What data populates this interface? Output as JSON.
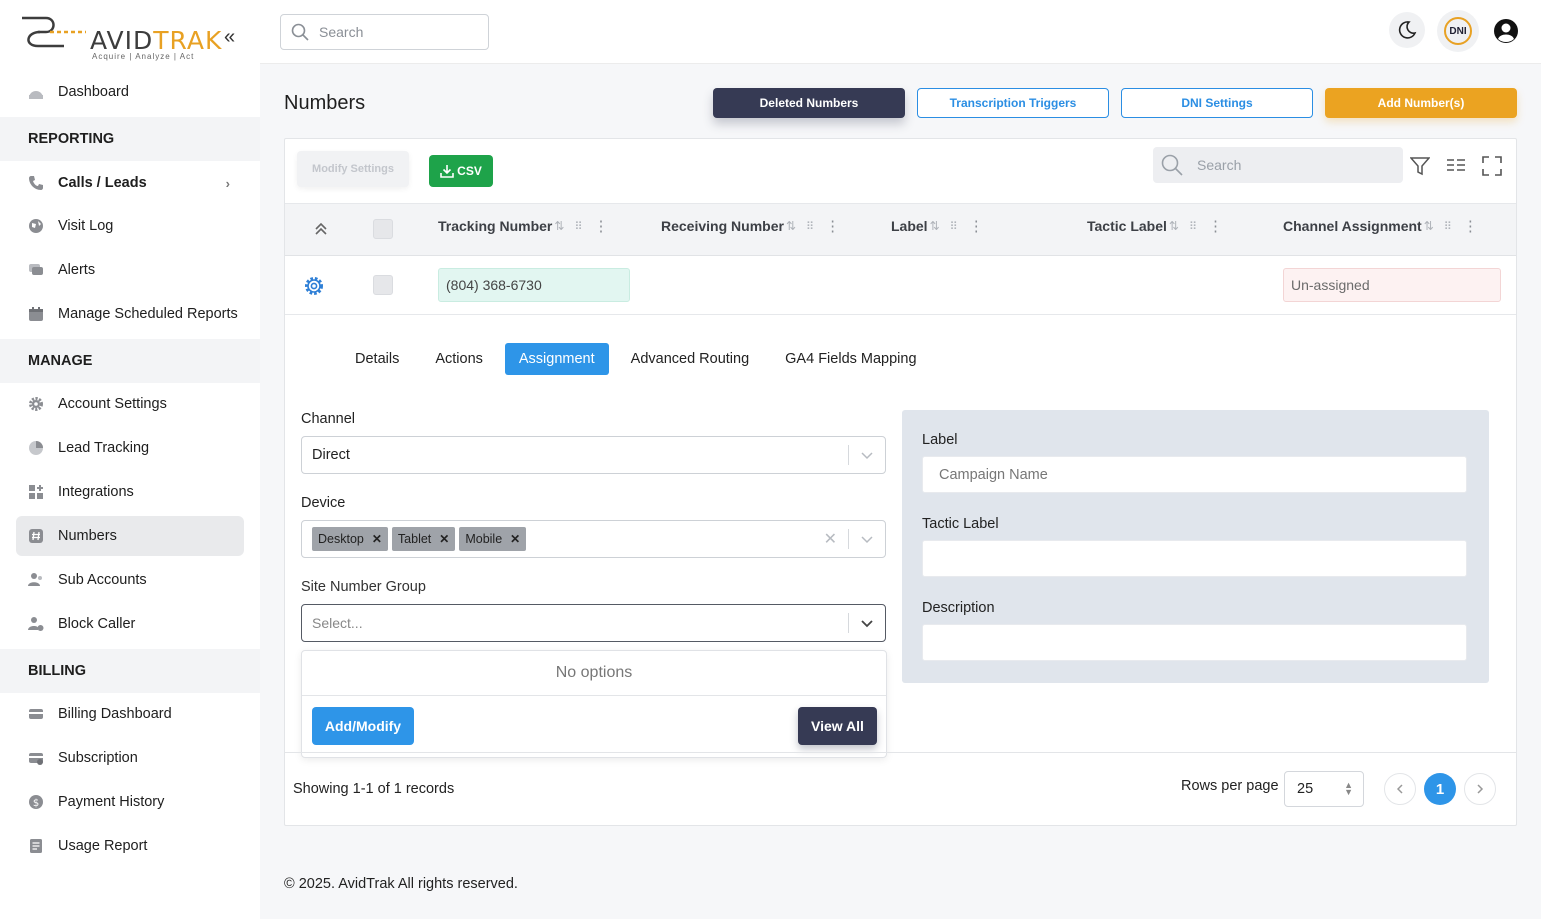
{
  "brand": {
    "name_prefix": "AVID",
    "name_suffix": "TRAK",
    "tagline": "Acquire  |  Analyze  |  Act"
  },
  "sidebar": {
    "items": [
      {
        "label": "Dashboard",
        "icon": "dashboard-icon"
      },
      {
        "section": "REPORTING"
      },
      {
        "label": "Calls / Leads",
        "icon": "phone-icon"
      },
      {
        "label": "Visit Log",
        "icon": "globe-icon"
      },
      {
        "label": "Alerts",
        "icon": "chat-icon"
      },
      {
        "label": "Manage Scheduled Reports",
        "icon": "calendar-icon"
      },
      {
        "section": "MANAGE"
      },
      {
        "label": "Account Settings",
        "icon": "gear-icon"
      },
      {
        "label": "Lead Tracking",
        "icon": "pie-icon"
      },
      {
        "label": "Integrations",
        "icon": "grid-plus-icon"
      },
      {
        "label": "Numbers",
        "icon": "hash-icon"
      },
      {
        "label": "Sub Accounts",
        "icon": "users-icon"
      },
      {
        "label": "Block Caller",
        "icon": "user-block-icon"
      },
      {
        "section": "BILLING"
      },
      {
        "label": "Billing Dashboard",
        "icon": "card-icon"
      },
      {
        "label": "Subscription",
        "icon": "card-gear-icon"
      },
      {
        "label": "Payment History",
        "icon": "dollar-icon"
      },
      {
        "label": "Usage Report",
        "icon": "report-icon"
      }
    ]
  },
  "topbar": {
    "search_placeholder": "Search",
    "dni_badge": "DNI"
  },
  "page": {
    "title": "Numbers",
    "buttons": {
      "deleted": "Deleted Numbers",
      "transcription": "Transcription Triggers",
      "dni": "DNI Settings",
      "add": "Add Number(s)"
    }
  },
  "table": {
    "modify_settings": "Modify Settings",
    "csv": "CSV",
    "search_placeholder": "Search",
    "columns": [
      "Tracking Number",
      "Receiving Number",
      "Label",
      "Tactic Label",
      "Channel Assignment"
    ],
    "row": {
      "tracking_number": "(804) 368-6730",
      "channel_assignment": "Un-assigned"
    },
    "tabs": [
      "Details",
      "Actions",
      "Assignment",
      "Advanced Routing",
      "GA4 Fields Mapping"
    ],
    "active_tab": "Assignment",
    "form": {
      "channel_label": "Channel",
      "channel_value": "Direct",
      "device_label": "Device",
      "devices": [
        "Desktop",
        "Tablet",
        "Mobile"
      ],
      "site_group_label": "Site Number Group",
      "site_group_placeholder": "Select...",
      "no_options": "No options",
      "add_modify": "Add/Modify",
      "view_all": "View All"
    },
    "panel": {
      "label_label": "Label",
      "label_placeholder": "Campaign Name",
      "tactic_label": "Tactic Label",
      "description_label": "Description"
    },
    "footer": {
      "records": "Showing 1-1 of 1 records",
      "rows_per_page_label": "Rows per page",
      "rows_per_page": "25",
      "current_page": "1"
    }
  },
  "footer": {
    "copyright": "© 2025. AvidTrak All rights reserved."
  },
  "colors": {
    "accent_blue": "#2e95e8",
    "dark_navy": "#363a54",
    "orange": "#eba321",
    "green": "#1ea34a"
  }
}
